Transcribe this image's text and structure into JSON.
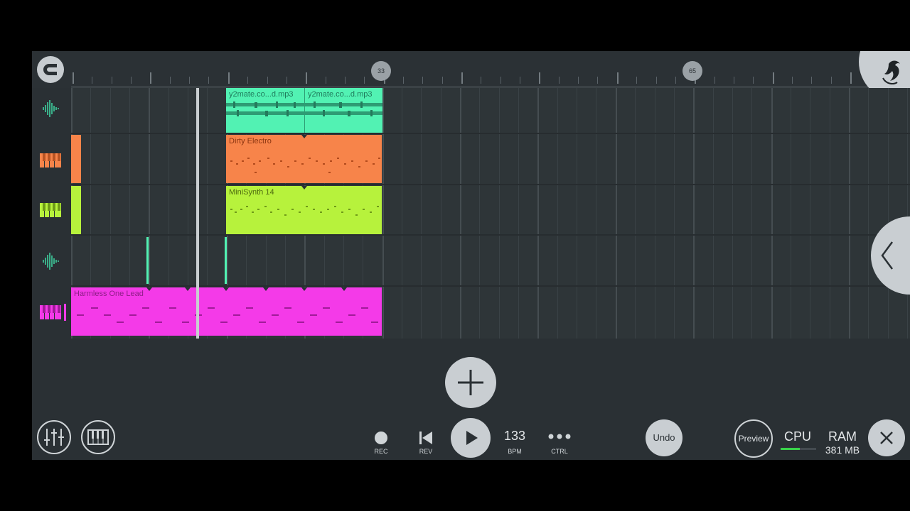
{
  "ruler": {
    "markers": [
      "33",
      "65"
    ]
  },
  "clips": {
    "audio1a": "y2mate.co...d.mp3",
    "audio1b": "y2mate.co...d.mp3",
    "dirty": "Dirty Electro",
    "minisynth": "MiniSynth 14",
    "harmless": "Harmless One Lead"
  },
  "colors": {
    "audio": "#52f2b3",
    "dirty": "#f7844a",
    "minisynth": "#b7f23c",
    "harmless": "#f43ae8",
    "audio2": "#52f2b3"
  },
  "transport": {
    "rec": "REC",
    "rev": "REV",
    "tempo": "133",
    "tempo_label": "BPM",
    "ctrl": "CTRL",
    "undo": "Undo",
    "preview": "Preview",
    "cpu": "CPU",
    "ram": "RAM",
    "ram_value": "381 MB"
  },
  "icons": {
    "snap": "snap-magnet-icon",
    "fl_logo": "fl-studio-logo-icon",
    "add": "plus-icon",
    "collapse": "chevron-left-icon",
    "mixer": "mixer-sliders-icon",
    "piano": "piano-keys-icon",
    "close": "close-icon"
  }
}
